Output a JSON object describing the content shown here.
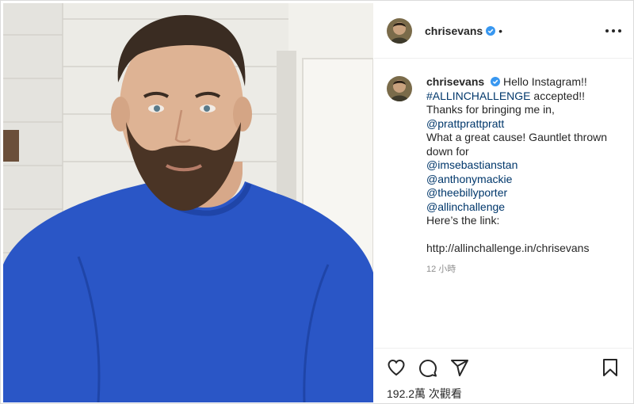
{
  "post": {
    "username": "chrisevans",
    "header_separator": "•",
    "caption_lines": [
      {
        "type": "mixed",
        "parts": [
          {
            "kind": "text",
            "text": "Hello Instagram!! "
          },
          {
            "kind": "link",
            "text": "#ALLINCHALLENGE"
          },
          {
            "kind": "text",
            "text": " accepted!! Thanks for bringing me in, "
          },
          {
            "kind": "link",
            "text": "@prattprattpratt"
          },
          {
            "kind": "text",
            "text": " What a great cause! Gauntlet thrown down for"
          }
        ]
      }
    ],
    "caption": {
      "intro": "Hello Instagram!!",
      "hashtag": "#ALLINCHALLENGE",
      "after_hashtag": " accepted!! Thanks for bringing me in, ",
      "mention_1": "@prattprattpratt",
      "after_mention": "What a great cause! Gauntlet thrown down for",
      "tags": [
        "@imsebastianstan",
        "@anthonymackie",
        "@theebillyporter",
        "@allinchallenge"
      ],
      "link_label": "Here’s the link:",
      "url": "http://allinchallenge.in/chrisevans"
    },
    "timestamp": "12 小時",
    "views": "192.2萬 次觀看",
    "icons": {
      "verified": "verified-badge-icon",
      "more": "more-options-icon",
      "like": "heart-icon",
      "comment": "comment-bubble-icon",
      "share": "paper-plane-icon",
      "save": "bookmark-icon"
    },
    "colors": {
      "link": "#00376b",
      "verified": "#3897f0",
      "muted": "#8e8e8e",
      "sweater": "#2a56c6"
    }
  }
}
